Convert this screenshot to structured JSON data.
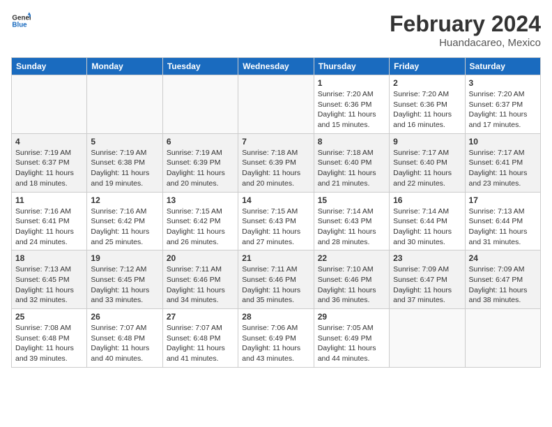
{
  "header": {
    "logo_line1": "General",
    "logo_line2": "Blue",
    "title": "February 2024",
    "subtitle": "Huandacareo, Mexico"
  },
  "days_of_week": [
    "Sunday",
    "Monday",
    "Tuesday",
    "Wednesday",
    "Thursday",
    "Friday",
    "Saturday"
  ],
  "weeks": [
    [
      {
        "day": "",
        "info": ""
      },
      {
        "day": "",
        "info": ""
      },
      {
        "day": "",
        "info": ""
      },
      {
        "day": "",
        "info": ""
      },
      {
        "day": "1",
        "info": "Sunrise: 7:20 AM\nSunset: 6:36 PM\nDaylight: 11 hours and 15 minutes."
      },
      {
        "day": "2",
        "info": "Sunrise: 7:20 AM\nSunset: 6:36 PM\nDaylight: 11 hours and 16 minutes."
      },
      {
        "day": "3",
        "info": "Sunrise: 7:20 AM\nSunset: 6:37 PM\nDaylight: 11 hours and 17 minutes."
      }
    ],
    [
      {
        "day": "4",
        "info": "Sunrise: 7:19 AM\nSunset: 6:37 PM\nDaylight: 11 hours and 18 minutes."
      },
      {
        "day": "5",
        "info": "Sunrise: 7:19 AM\nSunset: 6:38 PM\nDaylight: 11 hours and 19 minutes."
      },
      {
        "day": "6",
        "info": "Sunrise: 7:19 AM\nSunset: 6:39 PM\nDaylight: 11 hours and 20 minutes."
      },
      {
        "day": "7",
        "info": "Sunrise: 7:18 AM\nSunset: 6:39 PM\nDaylight: 11 hours and 20 minutes."
      },
      {
        "day": "8",
        "info": "Sunrise: 7:18 AM\nSunset: 6:40 PM\nDaylight: 11 hours and 21 minutes."
      },
      {
        "day": "9",
        "info": "Sunrise: 7:17 AM\nSunset: 6:40 PM\nDaylight: 11 hours and 22 minutes."
      },
      {
        "day": "10",
        "info": "Sunrise: 7:17 AM\nSunset: 6:41 PM\nDaylight: 11 hours and 23 minutes."
      }
    ],
    [
      {
        "day": "11",
        "info": "Sunrise: 7:16 AM\nSunset: 6:41 PM\nDaylight: 11 hours and 24 minutes."
      },
      {
        "day": "12",
        "info": "Sunrise: 7:16 AM\nSunset: 6:42 PM\nDaylight: 11 hours and 25 minutes."
      },
      {
        "day": "13",
        "info": "Sunrise: 7:15 AM\nSunset: 6:42 PM\nDaylight: 11 hours and 26 minutes."
      },
      {
        "day": "14",
        "info": "Sunrise: 7:15 AM\nSunset: 6:43 PM\nDaylight: 11 hours and 27 minutes."
      },
      {
        "day": "15",
        "info": "Sunrise: 7:14 AM\nSunset: 6:43 PM\nDaylight: 11 hours and 28 minutes."
      },
      {
        "day": "16",
        "info": "Sunrise: 7:14 AM\nSunset: 6:44 PM\nDaylight: 11 hours and 30 minutes."
      },
      {
        "day": "17",
        "info": "Sunrise: 7:13 AM\nSunset: 6:44 PM\nDaylight: 11 hours and 31 minutes."
      }
    ],
    [
      {
        "day": "18",
        "info": "Sunrise: 7:13 AM\nSunset: 6:45 PM\nDaylight: 11 hours and 32 minutes."
      },
      {
        "day": "19",
        "info": "Sunrise: 7:12 AM\nSunset: 6:45 PM\nDaylight: 11 hours and 33 minutes."
      },
      {
        "day": "20",
        "info": "Sunrise: 7:11 AM\nSunset: 6:46 PM\nDaylight: 11 hours and 34 minutes."
      },
      {
        "day": "21",
        "info": "Sunrise: 7:11 AM\nSunset: 6:46 PM\nDaylight: 11 hours and 35 minutes."
      },
      {
        "day": "22",
        "info": "Sunrise: 7:10 AM\nSunset: 6:46 PM\nDaylight: 11 hours and 36 minutes."
      },
      {
        "day": "23",
        "info": "Sunrise: 7:09 AM\nSunset: 6:47 PM\nDaylight: 11 hours and 37 minutes."
      },
      {
        "day": "24",
        "info": "Sunrise: 7:09 AM\nSunset: 6:47 PM\nDaylight: 11 hours and 38 minutes."
      }
    ],
    [
      {
        "day": "25",
        "info": "Sunrise: 7:08 AM\nSunset: 6:48 PM\nDaylight: 11 hours and 39 minutes."
      },
      {
        "day": "26",
        "info": "Sunrise: 7:07 AM\nSunset: 6:48 PM\nDaylight: 11 hours and 40 minutes."
      },
      {
        "day": "27",
        "info": "Sunrise: 7:07 AM\nSunset: 6:48 PM\nDaylight: 11 hours and 41 minutes."
      },
      {
        "day": "28",
        "info": "Sunrise: 7:06 AM\nSunset: 6:49 PM\nDaylight: 11 hours and 43 minutes."
      },
      {
        "day": "29",
        "info": "Sunrise: 7:05 AM\nSunset: 6:49 PM\nDaylight: 11 hours and 44 minutes."
      },
      {
        "day": "",
        "info": ""
      },
      {
        "day": "",
        "info": ""
      }
    ]
  ]
}
